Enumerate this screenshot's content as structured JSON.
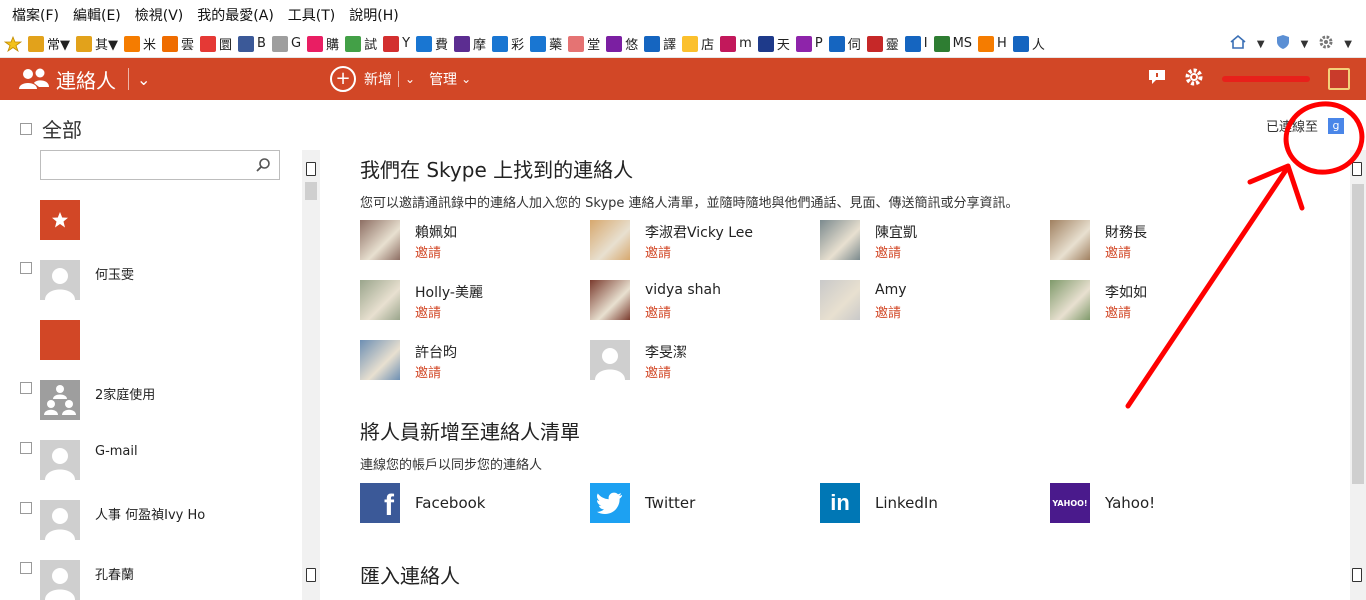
{
  "menubar": {
    "items": [
      "檔案(F)",
      "編輯(E)",
      "檢視(V)",
      "我的最愛(A)",
      "工具(T)",
      "說明(H)"
    ]
  },
  "favorites": [
    {
      "label": "常▼",
      "color": "#e2a21b"
    },
    {
      "label": "其▼",
      "color": "#e2a21b"
    },
    {
      "label": "米",
      "color": "#f57c00"
    },
    {
      "label": "雲",
      "color": "#ef6c00"
    },
    {
      "label": "圜",
      "color": "#e53935"
    },
    {
      "label": "B",
      "color": "#3b5998"
    },
    {
      "label": "G",
      "color": "#9e9e9e"
    },
    {
      "label": "購",
      "color": "#e91e63"
    },
    {
      "label": "試",
      "color": "#43a047"
    },
    {
      "label": "Y",
      "color": "#d32f2f"
    },
    {
      "label": "費",
      "color": "#1976d2"
    },
    {
      "label": "摩",
      "color": "#5c2d91"
    },
    {
      "label": "彩",
      "color": "#1976d2"
    },
    {
      "label": "藥",
      "color": "#1976d2"
    },
    {
      "label": "堂",
      "color": "#e57373"
    },
    {
      "label": "悠",
      "color": "#7b1fa2"
    },
    {
      "label": "譯",
      "color": "#1565c0"
    },
    {
      "label": "店",
      "color": "#fbc02d"
    },
    {
      "label": "m",
      "color": "#c2185b"
    },
    {
      "label": "天",
      "color": "#1e3a8a"
    },
    {
      "label": "P",
      "color": "#8e24aa"
    },
    {
      "label": "伺",
      "color": "#1565c0"
    },
    {
      "label": "靈",
      "color": "#c62828"
    },
    {
      "label": "I",
      "color": "#1565c0"
    },
    {
      "label": "MS",
      "color": "#2e7d32"
    },
    {
      "label": "H",
      "color": "#f57c00"
    },
    {
      "label": "人",
      "color": "#1565c0"
    }
  ],
  "header": {
    "app_title": "連絡人",
    "new_label": "新增",
    "manage_label": "管理",
    "colors": {
      "accent": "#d24726"
    }
  },
  "sidebar": {
    "select_all": "全部",
    "search_placeholder": "",
    "contacts": [
      {
        "name": "何玉雯"
      },
      {
        "name": "2家庭使用"
      },
      {
        "name": "G-mail"
      },
      {
        "name": "人事 何盈禎Ivy Ho"
      },
      {
        "name": "孔春蘭"
      }
    ]
  },
  "main": {
    "connected_label": "已連線至",
    "connected_badge": "g",
    "skype_title": "我們在 Skype 上找到的連絡人",
    "skype_desc": "您可以邀請通訊錄中的連絡人加入您的 Skype 連絡人清單，並隨時隨地與他們通話、見面、傳送簡訊或分享資訊。",
    "invite_label": "邀請",
    "skype_contacts": [
      {
        "name": "賴姵如"
      },
      {
        "name": "李淑君Vicky Lee"
      },
      {
        "name": "陳宜凱"
      },
      {
        "name": "財務長"
      },
      {
        "name": "Holly-美麗"
      },
      {
        "name": "vidya shah"
      },
      {
        "name": "Amy"
      },
      {
        "name": "李如如"
      },
      {
        "name": "許台昀"
      },
      {
        "name": "李旻潔"
      }
    ],
    "add_title": "將人員新增至連絡人清單",
    "add_desc": "連線您的帳戶以同步您的連絡人",
    "services": [
      {
        "name": "Facebook",
        "logo": "f",
        "color": "#3b5998"
      },
      {
        "name": "Twitter",
        "logo": "t",
        "color": "#1da1f2"
      },
      {
        "name": "LinkedIn",
        "logo": "in",
        "color": "#0077b5"
      },
      {
        "name": "Yahoo!",
        "logo": "YAHOO!",
        "color": "#4a1a8c"
      }
    ],
    "import_title": "匯入連絡人"
  }
}
